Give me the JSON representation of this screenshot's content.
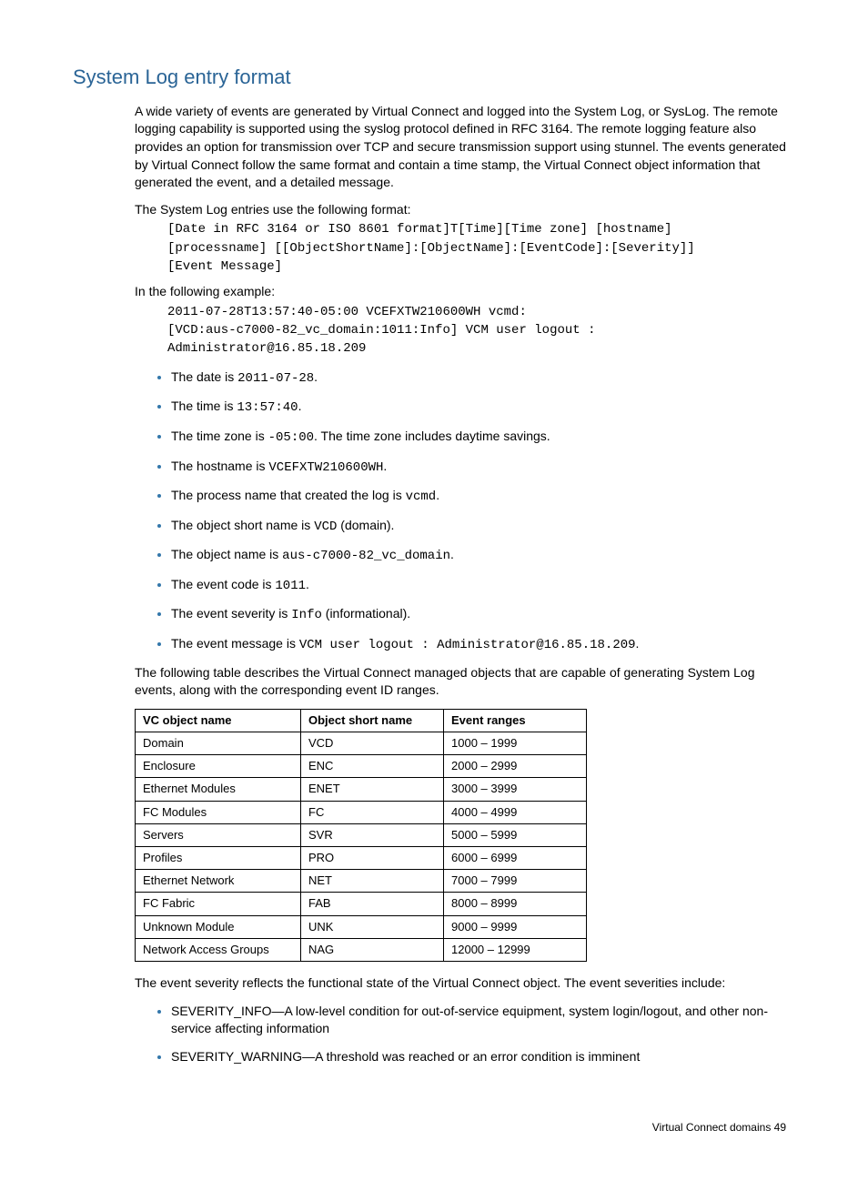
{
  "heading": "System Log entry format",
  "para1": "A wide variety of events are generated by Virtual Connect and logged into the System Log, or SysLog. The remote logging capability is supported using the syslog protocol defined in RFC 3164. The remote logging feature also provides an option for transmission over TCP and secure transmission support using stunnel. The events generated by Virtual Connect follow the same format and contain a time stamp, the Virtual Connect object information that generated the event, and a detailed message.",
  "para2": "The System Log entries use the following format:",
  "format_block": "[Date in RFC 3164 or ISO 8601 format]T[Time][Time zone] [hostname]\n[processname] [[ObjectShortName]:[ObjectName]:[EventCode]:[Severity]]\n[Event Message]",
  "para3": "In the following example:",
  "example_block": "2011-07-28T13:57:40-05:00 VCEFXTW210600WH vcmd:\n[VCD:aus-c7000-82_vc_domain:1011:Info] VCM user logout :\nAdministrator@16.85.18.209",
  "bullets1": [
    {
      "pre": "The date is ",
      "code": "2011-07-28",
      "post": "."
    },
    {
      "pre": "The time is ",
      "code": "13:57:40",
      "post": "."
    },
    {
      "pre": "The time zone is ",
      "code": "-05:00",
      "post": ". The time zone includes daytime savings."
    },
    {
      "pre": "The hostname is ",
      "code": "VCEFXTW210600WH",
      "post": "."
    },
    {
      "pre": "The process name that created the log is ",
      "code": "vcmd",
      "post": "."
    },
    {
      "pre": "The object short name is ",
      "code": "VCD",
      "post": " (domain)."
    },
    {
      "pre": "The object name is ",
      "code": "aus-c7000-82_vc_domain",
      "post": "."
    },
    {
      "pre": "The event code is ",
      "code": "1011",
      "post": "."
    },
    {
      "pre": "The event severity is ",
      "code": "Info",
      "post": " (informational)."
    },
    {
      "pre": "The event message is ",
      "code": "VCM user logout : Administrator@16.85.18.209",
      "post": "."
    }
  ],
  "para4": "The following table describes the Virtual Connect managed objects that are capable of generating System Log events, along with the corresponding event ID ranges.",
  "table": {
    "headers": [
      "VC object name",
      "Object short name",
      "Event ranges"
    ],
    "rows": [
      [
        "Domain",
        "VCD",
        "1000 – 1999"
      ],
      [
        "Enclosure",
        "ENC",
        "2000 – 2999"
      ],
      [
        "Ethernet Modules",
        "ENET",
        "3000 – 3999"
      ],
      [
        "FC Modules",
        "FC",
        "4000 – 4999"
      ],
      [
        "Servers",
        "SVR",
        "5000 – 5999"
      ],
      [
        "Profiles",
        "PRO",
        "6000 – 6999"
      ],
      [
        "Ethernet Network",
        "NET",
        "7000 – 7999"
      ],
      [
        "FC Fabric",
        "FAB",
        "8000 – 8999"
      ],
      [
        "Unknown Module",
        "UNK",
        "9000 – 9999"
      ],
      [
        "Network Access Groups",
        "NAG",
        "12000 – 12999"
      ]
    ]
  },
  "para5": "The event severity reflects the functional state of the Virtual Connect object. The event severities include:",
  "bullets2": [
    "SEVERITY_INFO—A low-level condition for out-of-service equipment, system login/logout, and other non-service affecting information",
    "SEVERITY_WARNING—A threshold was reached or an error condition is imminent"
  ],
  "footer": "Virtual Connect domains   49"
}
